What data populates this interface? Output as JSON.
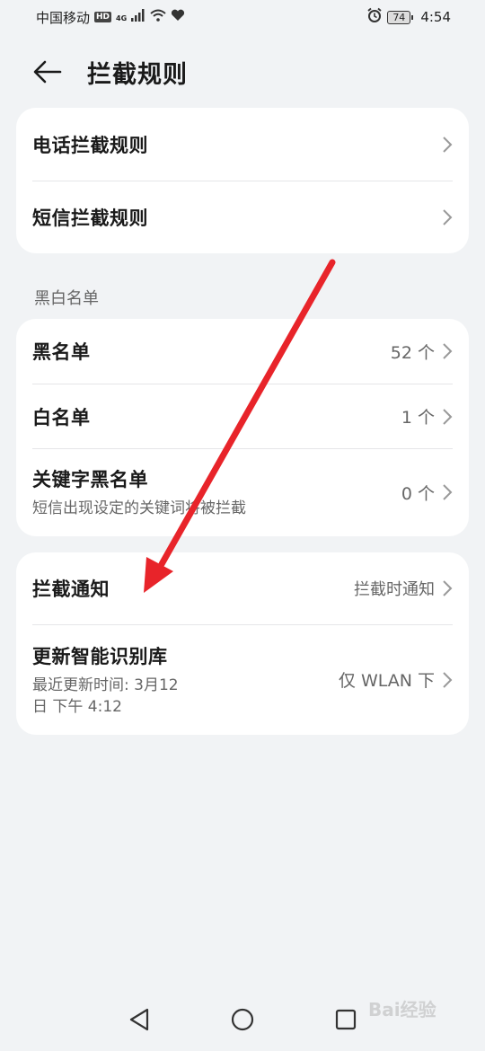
{
  "status_bar": {
    "carrier": "中国移动",
    "hd_badge": "HD",
    "network": "4G",
    "battery": "74",
    "time": "4:54"
  },
  "header": {
    "title": "拦截规则",
    "back_icon": "arrow-left-icon"
  },
  "rules_card": {
    "items": [
      {
        "label": "电话拦截规则"
      },
      {
        "label": "短信拦截规则"
      }
    ]
  },
  "blackwhite_section": {
    "label": "黑白名单",
    "items": [
      {
        "label": "黑名单",
        "value": "52 个"
      },
      {
        "label": "白名单",
        "value": "1 个"
      },
      {
        "label": "关键字黑名单",
        "sub": "短信出现设定的关键词将被拦截",
        "value": "0 个"
      }
    ]
  },
  "notify_card": {
    "items": [
      {
        "label": "拦截通知",
        "value": "拦截时通知"
      },
      {
        "label": "更新智能识别库",
        "sub": "最近更新时间: 3月12日 下午 4:12",
        "value": "仅 WLAN 下"
      }
    ]
  },
  "nav_bar": {
    "back_icon": "triangle-back-icon",
    "home_icon": "circle-home-icon",
    "recents_icon": "square-recents-icon"
  },
  "annotation": {
    "arrow_color": "#e8242a"
  },
  "watermark": "Bai经验"
}
